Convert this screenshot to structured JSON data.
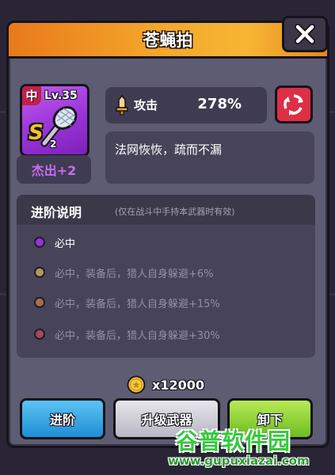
{
  "dialog": {
    "title": "苍蝇拍",
    "close_icon": "close-x-icon"
  },
  "item": {
    "grade_tag": "中",
    "level": "Lv.35",
    "icon": "fly-swatter-icon",
    "rank_letter": "S",
    "rank_number": "2",
    "quality": "杰出+2"
  },
  "stat": {
    "icon": "sword-icon",
    "label": "攻击",
    "value": "278%"
  },
  "refresh_icon": "refresh-cycle-icon",
  "description": "法网恢恢，疏而不漏",
  "advancement": {
    "title": "进阶说明",
    "note": "(仅在战斗中手持本武器时有效)",
    "rows": [
      {
        "text": "必中",
        "color": "#9b2fd9",
        "active": true
      },
      {
        "text": "必中，装备后，猎人自身躲避+6%",
        "color": "#b09a5a",
        "active": false
      },
      {
        "text": "必中，装备后，猎人自身躲避+15%",
        "color": "#a5704c",
        "active": false
      },
      {
        "text": "必中，装备后，猎人自身躲避+30%",
        "color": "#a24a5a",
        "active": false
      }
    ]
  },
  "cost": {
    "icon": "gold-coin-icon",
    "text": "x12000"
  },
  "buttons": {
    "advance": "进阶",
    "upgrade": "升级武器",
    "unequip": "卸下"
  },
  "watermark": {
    "main": "谷普软件园",
    "url": "www.gupuxiazai.com"
  },
  "colors": {
    "title_bar": "#f3a52a",
    "panel": "#5d5c72",
    "quality_purple": "#c96bf5",
    "advance_blue": "#1f8ed6",
    "unequip_green": "#6cbd22",
    "refresh_red": "#dd2f45"
  }
}
